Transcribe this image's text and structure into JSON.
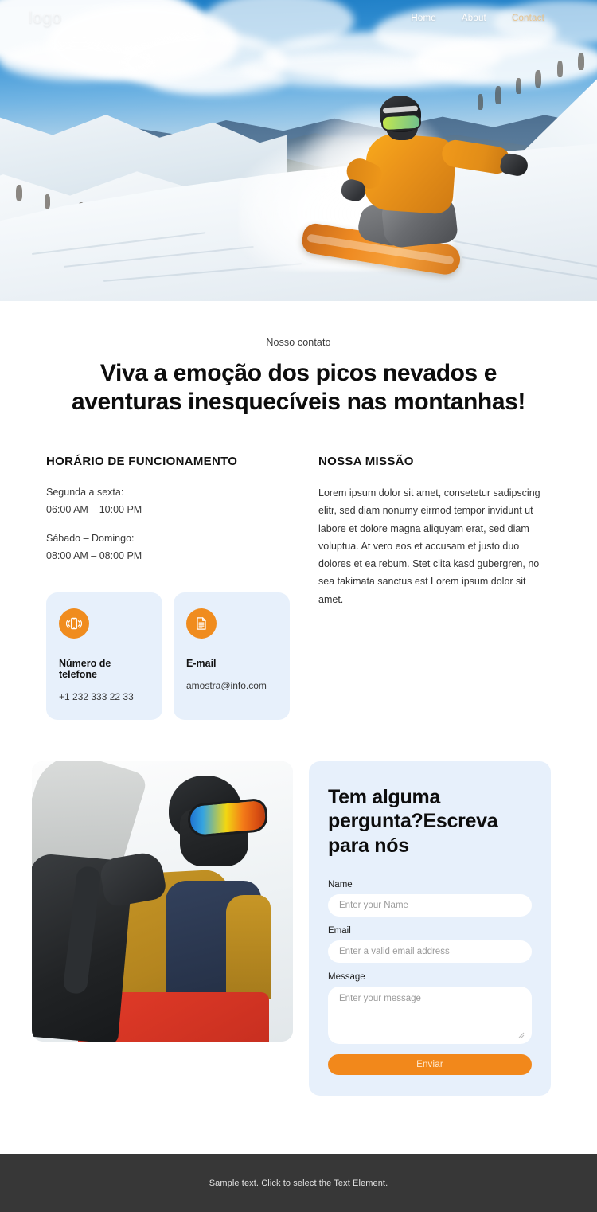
{
  "nav": {
    "logo": "logo",
    "links": [
      {
        "label": "Home",
        "accent": false
      },
      {
        "label": "About",
        "accent": false
      },
      {
        "label": "Contact",
        "accent": true
      }
    ]
  },
  "hero": {
    "alt": "Snowboarder carving fresh powder on a sunlit mountain slope"
  },
  "intro": {
    "eyebrow": "Nosso contato",
    "headline": "Viva a emoção dos picos nevados e aventuras inesquecíveis nas montanhas!"
  },
  "hours": {
    "title": "HORÁRIO DE FUNCIONAMENTO",
    "weekday_label": "Segunda a sexta:",
    "weekday_time": "06:00 AM – 10:00 PM",
    "weekend_label": "Sábado – Domingo:",
    "weekend_time": "08:00 AM – 08:00 PM"
  },
  "mission": {
    "title": "NOSSA MISSÃO",
    "body": "Lorem ipsum dolor sit amet, consetetur sadipscing elitr, sed diam nonumy eirmod tempor invidunt ut labore et dolore magna aliquyam erat, sed diam voluptua. At vero eos et accusam et justo duo dolores et ea rebum. Stet clita kasd gubergren, no sea takimata sanctus est Lorem ipsum dolor sit amet."
  },
  "contact_cards": [
    {
      "icon": "mobile-phone-ringing-icon",
      "label": "Número de telefone",
      "value": "+1 232 333 22 33"
    },
    {
      "icon": "document-icon",
      "label": "E-mail",
      "value": "amostra@info.com"
    }
  ],
  "photo2": {
    "alt": "Snowboarder in yellow and navy jacket carrying a board, wearing mirrored goggles"
  },
  "form": {
    "title": "Tem alguma pergunta?Escreva para nós",
    "name_label": "Name",
    "name_placeholder": "Enter your Name",
    "email_label": "Email",
    "email_placeholder": "Enter a valid email address",
    "message_label": "Message",
    "message_placeholder": "Enter your message",
    "submit_label": "Enviar"
  },
  "footer": {
    "text": "Sample text. Click to select the Text Element."
  },
  "colors": {
    "accent_orange": "#f08c1e",
    "card_blue": "#e7f0fb",
    "footer_dark": "#373737",
    "nav_accent": "#e7c48f"
  }
}
